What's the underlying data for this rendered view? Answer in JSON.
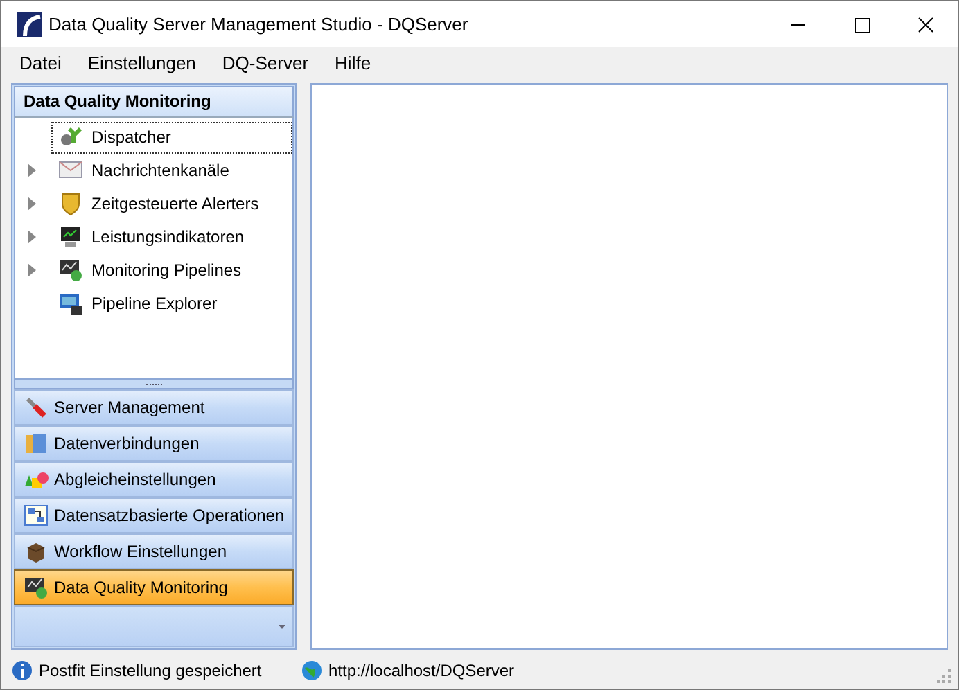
{
  "window": {
    "title": "Data Quality Server Management Studio - DQServer"
  },
  "menu": [
    "Datei",
    "Einstellungen",
    "DQ-Server",
    "Hilfe"
  ],
  "sidebar": {
    "title": "Data Quality Monitoring",
    "tree": [
      {
        "label": "Dispatcher",
        "expandable": false,
        "focused": true
      },
      {
        "label": "Nachrichtenkanäle",
        "expandable": true,
        "focused": false
      },
      {
        "label": "Zeitgesteuerte Alerters",
        "expandable": true,
        "focused": false
      },
      {
        "label": "Leistungsindikatoren",
        "expandable": true,
        "focused": false
      },
      {
        "label": "Monitoring Pipelines",
        "expandable": true,
        "focused": false
      },
      {
        "label": "Pipeline Explorer",
        "expandable": false,
        "focused": false
      }
    ],
    "sections": [
      {
        "label": "Server Management",
        "selected": false
      },
      {
        "label": "Datenverbindungen",
        "selected": false
      },
      {
        "label": "Abgleicheinstellungen",
        "selected": false
      },
      {
        "label": "Datensatzbasierte Operationen",
        "selected": false
      },
      {
        "label": "Workflow Einstellungen",
        "selected": false
      },
      {
        "label": "Data Quality Monitoring",
        "selected": true
      }
    ]
  },
  "status_bar": {
    "message": "Postfit Einstellung gespeichert",
    "url": "http://localhost/DQServer"
  }
}
